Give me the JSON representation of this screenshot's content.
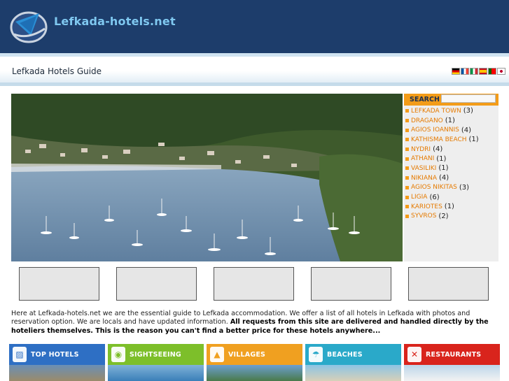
{
  "header": {
    "site_title": "Lefkada-hotels.net",
    "logo_icon": "sail-logo-icon"
  },
  "subheader": {
    "guide_title": "Lefkada Hotels Guide",
    "languages": [
      "de",
      "fr",
      "it",
      "es",
      "pt",
      "jp"
    ]
  },
  "sidebar": {
    "search_label": "SEARCH",
    "search_placeholder": "",
    "regions": [
      {
        "name": "LEFKADA TOWN",
        "count": "(3)"
      },
      {
        "name": "DRAGANO",
        "count": "(1)"
      },
      {
        "name": "AGIOS IOANNIS",
        "count": "(4)"
      },
      {
        "name": "KATHISMA BEACH",
        "count": "(1)"
      },
      {
        "name": "NYDRI",
        "count": "(4)"
      },
      {
        "name": "ATHANI",
        "count": "(1)"
      },
      {
        "name": "VASILIKI",
        "count": "(1)"
      },
      {
        "name": "NIKIANA",
        "count": "(4)"
      },
      {
        "name": "AGIOS NIKITAS",
        "count": "(3)"
      },
      {
        "name": "LIGIA",
        "count": "(6)"
      },
      {
        "name": "KARIOTES",
        "count": "(1)"
      },
      {
        "name": "SYVROS",
        "count": "(2)"
      }
    ]
  },
  "intro": {
    "text": "Here at Lefkada-hotels.net we are the essential guide to Lefkada accommodation. We offer a list of all hotels in Lefkada with photos and reservation option. We are locals and have updated information. ",
    "bold_text": "All requests from this site are delivered and handled directly by the hoteliers themselves. This is the reason you can't find a better price for these hotels anywhere..."
  },
  "categories": [
    {
      "label": "TOP HOTELS",
      "color": "#2e6fc4",
      "icon": "hotel-bed-icon"
    },
    {
      "label": "SIGHTSEEING",
      "color": "#7dbf2a",
      "icon": "camera-icon"
    },
    {
      "label": "VILLAGES",
      "color": "#f0a020",
      "icon": "landscape-icon"
    },
    {
      "label": "BEACHES",
      "color": "#2aa9c9",
      "icon": "beach-umbrella-icon"
    },
    {
      "label": "RESTAURANTS",
      "color": "#d9241c",
      "icon": "cutlery-icon"
    }
  ],
  "colors": {
    "header_bg": "#1d3d6b",
    "title_color": "#7fc8f0",
    "accent_orange": "#f39c19"
  }
}
